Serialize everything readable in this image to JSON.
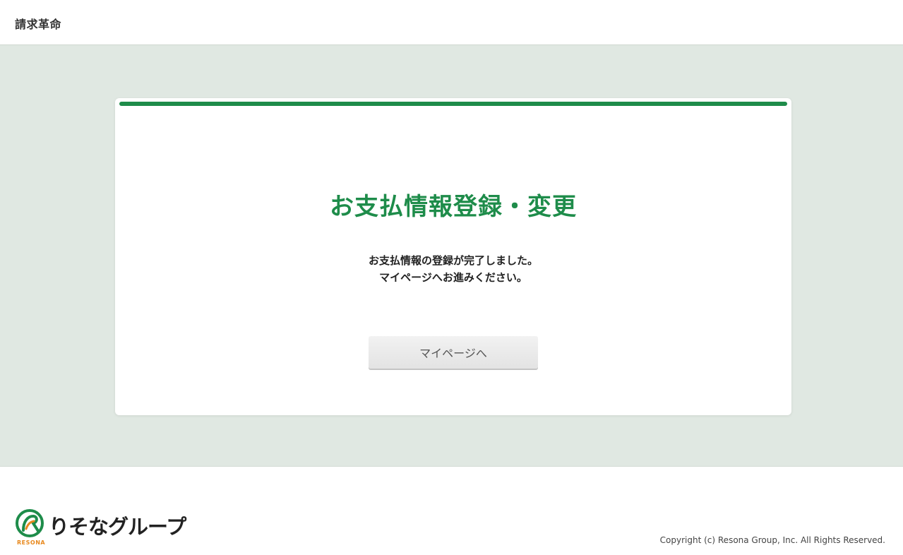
{
  "header": {
    "app_title": "請求革命"
  },
  "card": {
    "title": "お支払情報登録・変更",
    "message_line1": "お支払情報の登録が完了しました。",
    "message_line2": "マイページへお進みください。",
    "button_label": "マイページへ"
  },
  "footer": {
    "logo_text": "りそなグループ",
    "logo_sub": "RESONA",
    "copyright": "Copyright (c) Resona Group, Inc. All Rights Reserved."
  },
  "colors": {
    "accent": "#1e8c4a",
    "background": "#e0e8e2",
    "logo_orange": "#e8891e"
  },
  "icons": {
    "logo": "resona-logo-icon"
  }
}
